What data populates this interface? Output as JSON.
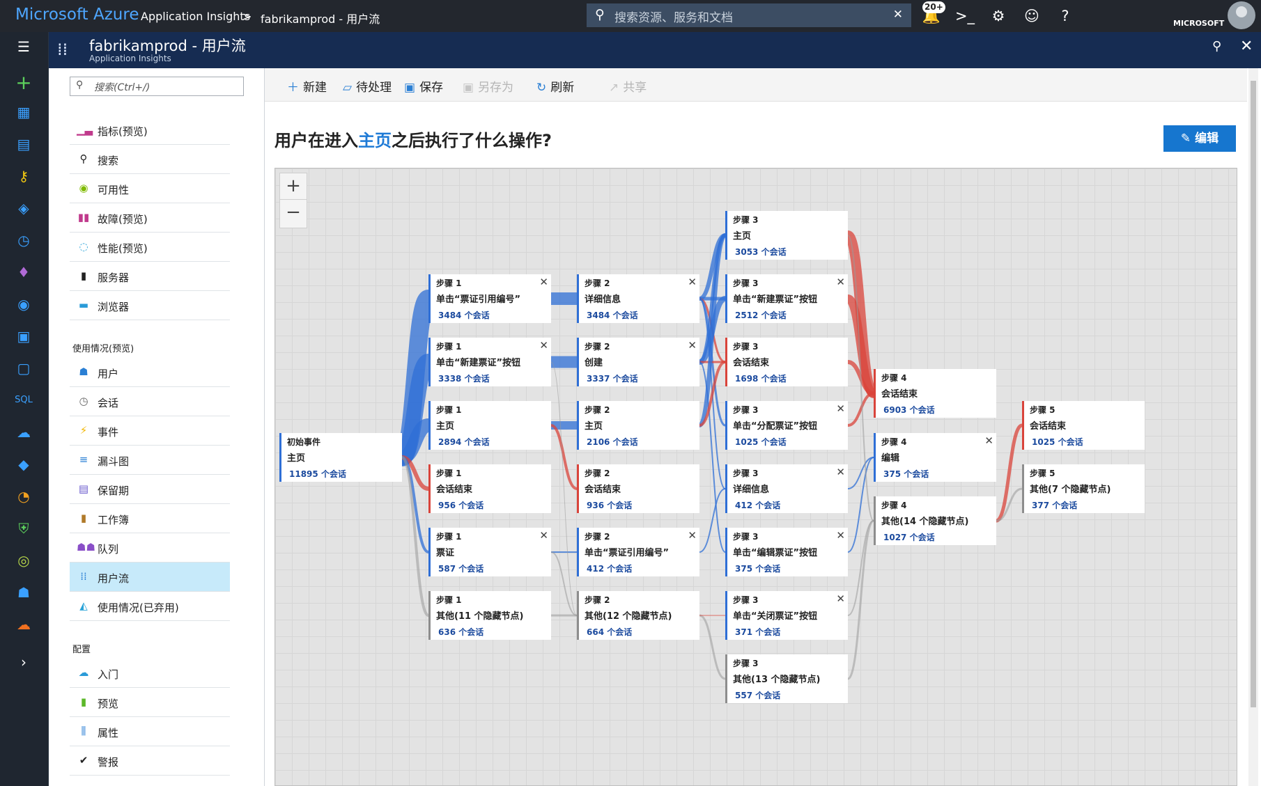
{
  "topbar": {
    "brand": "Microsoft Azure",
    "crumb1": "Application Insights",
    "crumb_sep": ">",
    "crumb2": "fabrikamprod - 用户流",
    "search_placeholder": "搜索资源、服务和文档",
    "notification_badge": "20+",
    "account": "MICROSOFT"
  },
  "blade": {
    "title": "fabrikamprod - 用户流",
    "subtitle": "Application Insights"
  },
  "menu": {
    "search_placeholder": "搜索(Ctrl+/)",
    "items_top": [
      {
        "label": "指标(预览)",
        "icon": "chart-icon"
      },
      {
        "label": "搜索",
        "icon": "search-icon"
      },
      {
        "label": "可用性",
        "icon": "globe-icon"
      },
      {
        "label": "故障(预览)",
        "icon": "failures-icon"
      },
      {
        "label": "性能(预览)",
        "icon": "performance-icon"
      },
      {
        "label": "服务器",
        "icon": "server-icon"
      },
      {
        "label": "浏览器",
        "icon": "browser-icon"
      }
    ],
    "section_usage": "使用情况(预览)",
    "items_usage": [
      {
        "label": "用户",
        "icon": "user-icon"
      },
      {
        "label": "会话",
        "icon": "sessions-icon"
      },
      {
        "label": "事件",
        "icon": "events-icon"
      },
      {
        "label": "漏斗图",
        "icon": "funnel-icon"
      },
      {
        "label": "保留期",
        "icon": "retention-icon"
      },
      {
        "label": "工作簿",
        "icon": "workbook-icon"
      },
      {
        "label": "队列",
        "icon": "cohorts-icon"
      },
      {
        "label": "用户流",
        "icon": "userflows-icon"
      },
      {
        "label": "使用情况(已弃用)",
        "icon": "usage-icon"
      }
    ],
    "section_config": "配置",
    "items_config": [
      {
        "label": "入门",
        "icon": "cloud-icon"
      },
      {
        "label": "预览",
        "icon": "bookmark-icon"
      },
      {
        "label": "属性",
        "icon": "properties-icon"
      },
      {
        "label": "警报",
        "icon": "check-icon"
      }
    ]
  },
  "toolbar": {
    "new": "新建",
    "pending": "待处理",
    "save": "保存",
    "save_as": "另存为",
    "refresh": "刷新",
    "share": "共享"
  },
  "heading": {
    "prefix": "用户在进入",
    "highlight": "主页",
    "suffix": "之后执行了什么操作?",
    "edit": "编辑"
  },
  "colors": {
    "accent": "#1676cf",
    "flow_blue": "#2f6fd6",
    "flow_red": "#d9443b",
    "flow_gray": "#9b9b9b"
  },
  "flow": {
    "session_suffix": "个会话",
    "nodes": [
      {
        "id": "n0",
        "step": "初始事件",
        "label": "主页",
        "count": "11895",
        "color": "blue",
        "close": false
      },
      {
        "id": "n1a",
        "step": "步骤 1",
        "label": "单击“票证引用编号”",
        "count": "3484",
        "color": "blue",
        "close": true
      },
      {
        "id": "n1b",
        "step": "步骤 1",
        "label": "单击“新建票证”按钮",
        "count": "3338",
        "color": "blue",
        "close": true
      },
      {
        "id": "n1c",
        "step": "步骤 1",
        "label": "主页",
        "count": "2894",
        "color": "blue",
        "close": false
      },
      {
        "id": "n1d",
        "step": "步骤 1",
        "label": "会话结束",
        "count": "956",
        "color": "red",
        "close": false
      },
      {
        "id": "n1e",
        "step": "步骤 1",
        "label": "票证",
        "count": "587",
        "color": "blue",
        "close": true
      },
      {
        "id": "n1f",
        "step": "步骤 1",
        "label": "其他(11 个隐藏节点)",
        "count": "636",
        "color": "gray",
        "close": false
      },
      {
        "id": "n2a",
        "step": "步骤 2",
        "label": "详细信息",
        "count": "3484",
        "color": "blue",
        "close": true
      },
      {
        "id": "n2b",
        "step": "步骤 2",
        "label": "创建",
        "count": "3337",
        "color": "blue",
        "close": true
      },
      {
        "id": "n2c",
        "step": "步骤 2",
        "label": "主页",
        "count": "2106",
        "color": "blue",
        "close": false
      },
      {
        "id": "n2d",
        "step": "步骤 2",
        "label": "会话结束",
        "count": "936",
        "color": "red",
        "close": false
      },
      {
        "id": "n2e",
        "step": "步骤 2",
        "label": "单击“票证引用编号”",
        "count": "412",
        "color": "blue",
        "close": true
      },
      {
        "id": "n2f",
        "step": "步骤 2",
        "label": "其他(12 个隐藏节点)",
        "count": "664",
        "color": "gray",
        "close": false
      },
      {
        "id": "n3a",
        "step": "步骤 3",
        "label": "主页",
        "count": "3053",
        "color": "blue",
        "close": false
      },
      {
        "id": "n3b",
        "step": "步骤 3",
        "label": "单击“新建票证”按钮",
        "count": "2512",
        "color": "blue",
        "close": true
      },
      {
        "id": "n3c",
        "step": "步骤 3",
        "label": "会话结束",
        "count": "1698",
        "color": "red",
        "close": false
      },
      {
        "id": "n3d",
        "step": "步骤 3",
        "label": "单击“分配票证”按钮",
        "count": "1025",
        "color": "blue",
        "close": true
      },
      {
        "id": "n3e",
        "step": "步骤 3",
        "label": "详细信息",
        "count": "412",
        "color": "blue",
        "close": true
      },
      {
        "id": "n3f",
        "step": "步骤 3",
        "label": "单击“编辑票证”按钮",
        "count": "375",
        "color": "blue",
        "close": true
      },
      {
        "id": "n3g",
        "step": "步骤 3",
        "label": "单击“关闭票证”按钮",
        "count": "371",
        "color": "blue",
        "close": true
      },
      {
        "id": "n3h",
        "step": "步骤 3",
        "label": "其他(13 个隐藏节点)",
        "count": "557",
        "color": "gray",
        "close": false
      },
      {
        "id": "n4a",
        "step": "步骤 4",
        "label": "会话结束",
        "count": "6903",
        "color": "red",
        "close": false
      },
      {
        "id": "n4b",
        "step": "步骤 4",
        "label": "编辑",
        "count": "375",
        "color": "blue",
        "close": true
      },
      {
        "id": "n4c",
        "step": "步骤 4",
        "label": "其他(14 个隐藏节点)",
        "count": "1027",
        "color": "gray",
        "close": false
      },
      {
        "id": "n5a",
        "step": "步骤 5",
        "label": "会话结束",
        "count": "1025",
        "color": "red",
        "close": false
      },
      {
        "id": "n5b",
        "step": "步骤 5",
        "label": "其他(7 个隐藏节点)",
        "count": "377",
        "color": "gray",
        "close": false
      }
    ]
  }
}
